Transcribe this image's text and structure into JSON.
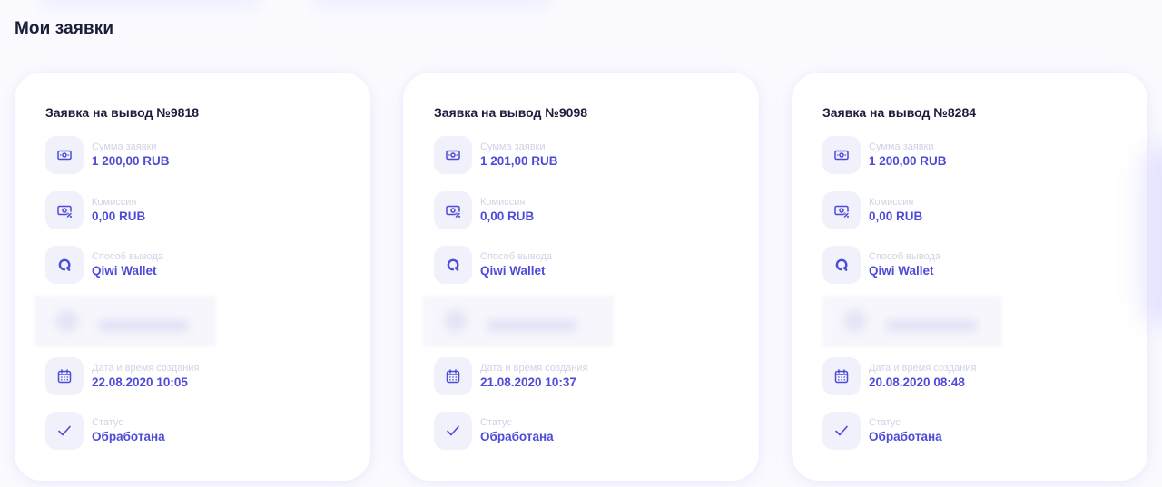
{
  "section": {
    "title": "Мои заявки"
  },
  "labels": {
    "amount": "Сумма заявки",
    "commission": "Комиссия",
    "method": "Способ вывода",
    "created": "Дата и время создания",
    "status": "Статус"
  },
  "requests": [
    {
      "title": "Заявка на вывод №9818",
      "amount": "1 200,00 RUB",
      "commission": "0,00 RUB",
      "method": "Qiwi Wallet",
      "created": "22.08.2020 10:05",
      "status": "Обработана"
    },
    {
      "title": "Заявка на вывод №9098",
      "amount": "1 201,00 RUB",
      "commission": "0,00 RUB",
      "method": "Qiwi Wallet",
      "created": "21.08.2020 10:37",
      "status": "Обработана"
    },
    {
      "title": "Заявка на вывод №8284",
      "amount": "1 200,00 RUB",
      "commission": "0,00 RUB",
      "method": "Qiwi Wallet",
      "created": "20.08.2020 08:48",
      "status": "Обработана"
    }
  ],
  "icons": {
    "amount": "banknote-icon",
    "commission": "banknote-percent-icon",
    "method": "qiwi-icon",
    "created": "calendar-icon",
    "status": "checkmark-icon"
  },
  "colors": {
    "accent": "#4d4bd8",
    "icon": "#4d4bd8",
    "title": "#1c1d3a",
    "label": "#d2d2e6",
    "icon_bg": "#f1f1fb"
  }
}
